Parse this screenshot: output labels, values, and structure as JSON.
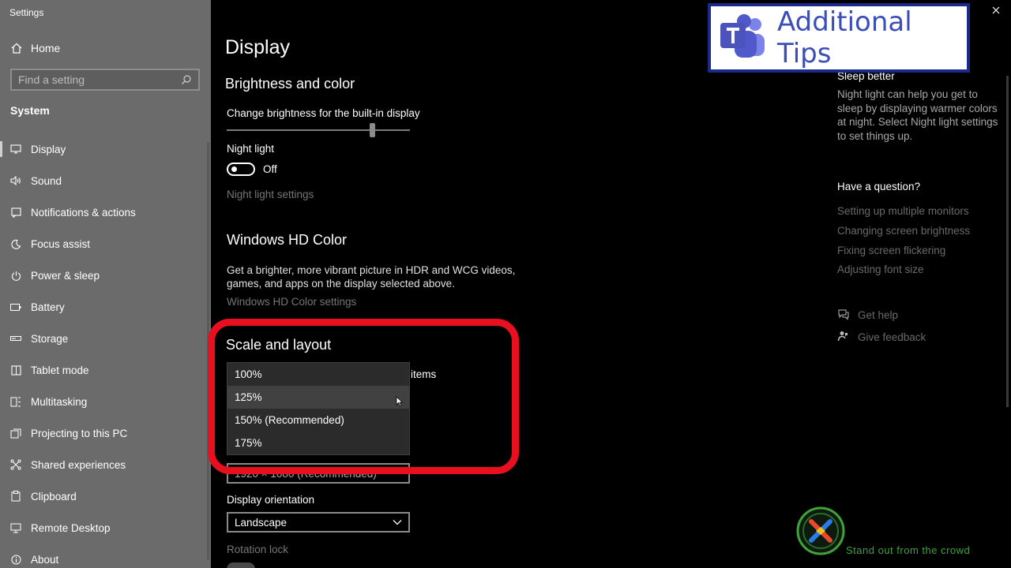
{
  "window": {
    "title": "Settings"
  },
  "sidebar": {
    "home_label": "Home",
    "search_placeholder": "Find a setting",
    "section_title": "System",
    "items": [
      {
        "label": "Display",
        "icon": "monitor-icon",
        "active": true
      },
      {
        "label": "Sound",
        "icon": "speaker-icon"
      },
      {
        "label": "Notifications & actions",
        "icon": "notification-icon"
      },
      {
        "label": "Focus assist",
        "icon": "moon-icon"
      },
      {
        "label": "Power & sleep",
        "icon": "power-icon"
      },
      {
        "label": "Battery",
        "icon": "battery-icon"
      },
      {
        "label": "Storage",
        "icon": "storage-icon"
      },
      {
        "label": "Tablet mode",
        "icon": "tablet-icon"
      },
      {
        "label": "Multitasking",
        "icon": "multitasking-icon"
      },
      {
        "label": "Projecting to this PC",
        "icon": "projector-icon"
      },
      {
        "label": "Shared experiences",
        "icon": "shared-icon"
      },
      {
        "label": "Clipboard",
        "icon": "clipboard-icon"
      },
      {
        "label": "Remote Desktop",
        "icon": "remote-desktop-icon"
      },
      {
        "label": "About",
        "icon": "info-icon"
      }
    ]
  },
  "main": {
    "title": "Display",
    "brightness": {
      "heading": "Brightness and color",
      "slider_label": "Change brightness for the built-in display",
      "night_light_label": "Night light",
      "night_light_state": "Off",
      "night_light_settings": "Night light settings"
    },
    "hdr": {
      "heading": "Windows HD Color",
      "description": "Get a brighter, more vibrant picture in HDR and WCG videos, games, and apps on the display selected above.",
      "link": "Windows HD Color settings"
    },
    "scale": {
      "heading": "Scale and layout",
      "partial_label": "items",
      "options": [
        "100%",
        "125%",
        "150% (Recommended)",
        "175%"
      ],
      "hovered_option": "125%",
      "resolution_value": "1920 × 1080 (Recommended)"
    },
    "orientation": {
      "label": "Display orientation",
      "value": "Landscape"
    },
    "rotation_lock_label": "Rotation lock"
  },
  "right": {
    "sleep_title": "Sleep better",
    "sleep_text": "Night light can help you get to sleep by displaying warmer colors at night. Select Night light settings to set things up.",
    "question_title": "Have a question?",
    "links": [
      "Setting up multiple monitors",
      "Changing screen brightness",
      "Fixing screen flickering",
      "Adjusting font size"
    ],
    "get_help": "Get help",
    "give_feedback": "Give feedback"
  },
  "overlay": {
    "banner_text": "Additional Tips",
    "watermark_text": "Stand out from the crowd",
    "highlight_color": "#e8101e",
    "brand_color": "#3a4db8"
  }
}
